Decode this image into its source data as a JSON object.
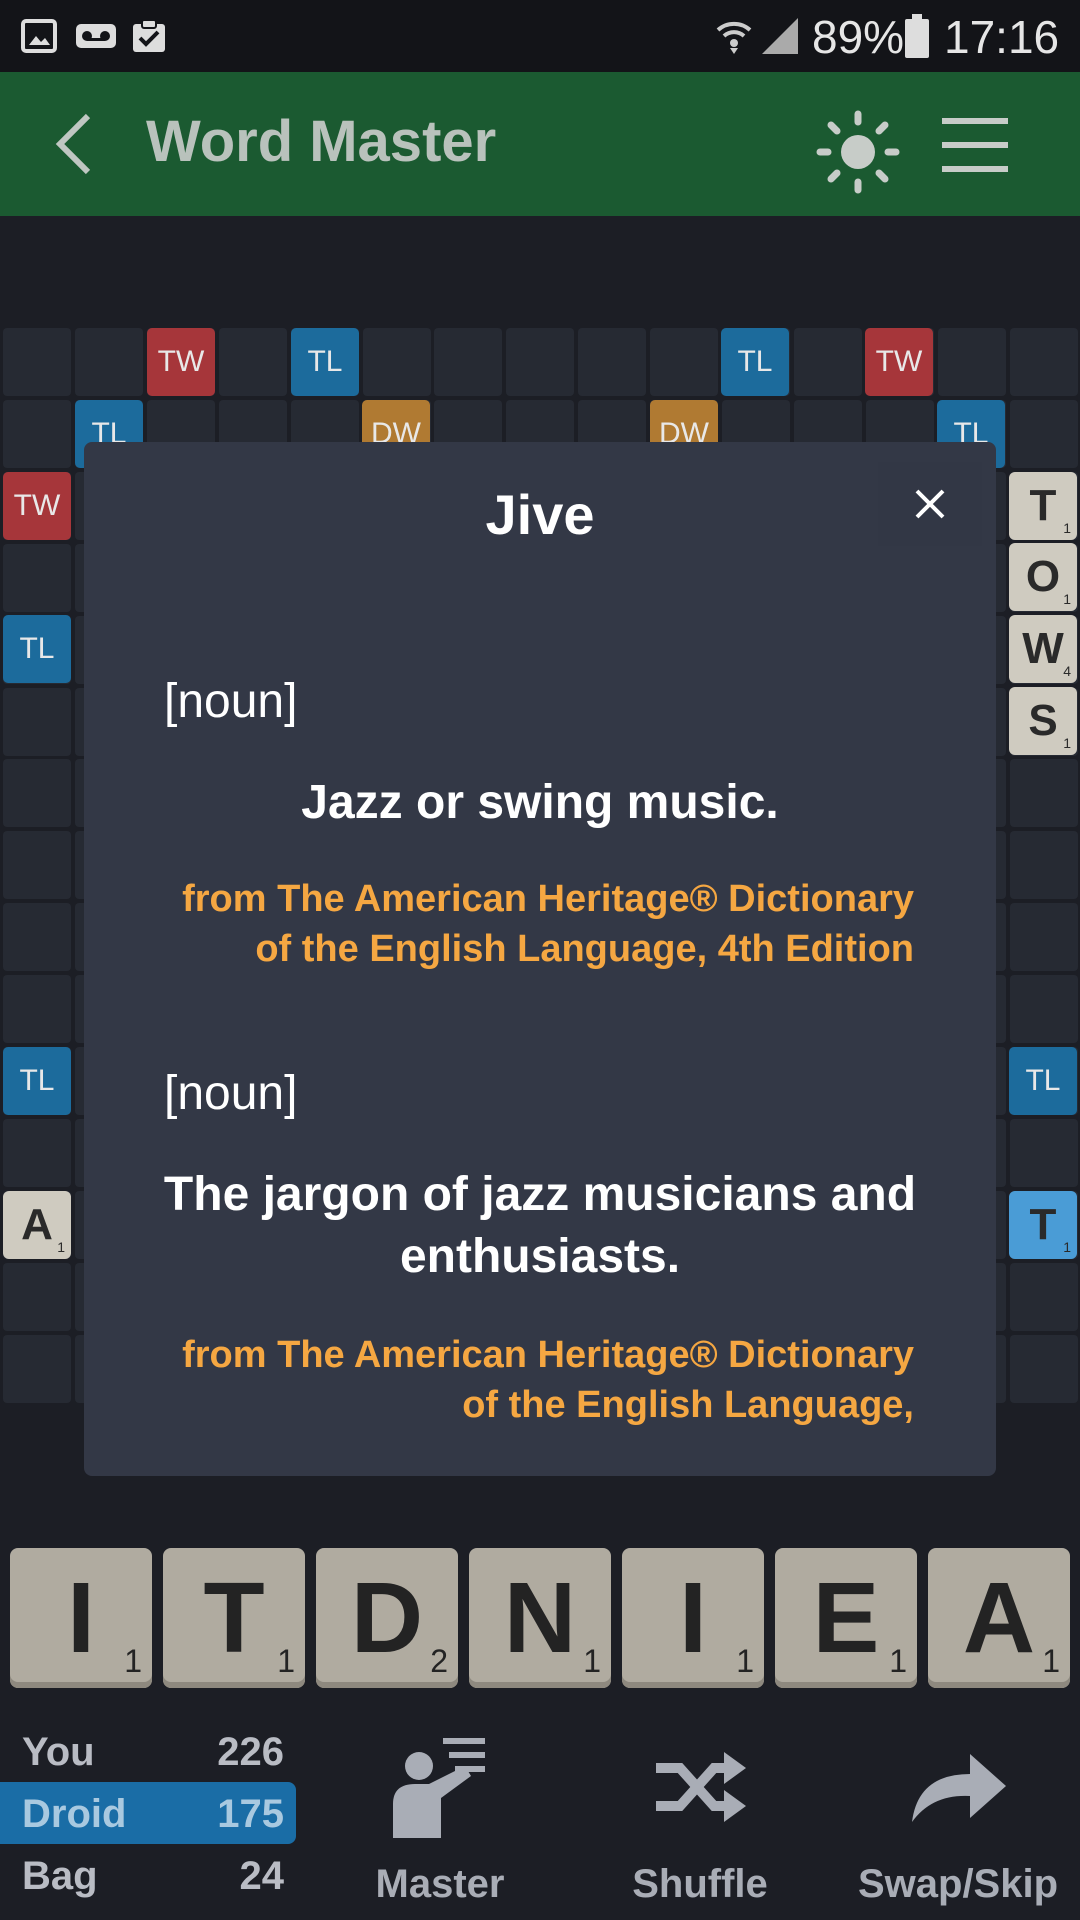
{
  "status_bar": {
    "battery": "89%",
    "time": "17:16"
  },
  "app_bar": {
    "title": "Word Master"
  },
  "board": {
    "bonus_labels": [
      "TW",
      "TL",
      "TL",
      "TW",
      "TL",
      "DW",
      "DW",
      "TL",
      "TW",
      "TL",
      "TL",
      "TL"
    ],
    "side_tiles": [
      {
        "letter": "T",
        "score": "1"
      },
      {
        "letter": "O",
        "score": "1"
      },
      {
        "letter": "W",
        "score": "4"
      },
      {
        "letter": "S",
        "score": "1"
      },
      {
        "letter": "A",
        "score": "1"
      },
      {
        "letter": "T",
        "score": "1"
      }
    ]
  },
  "dialog": {
    "word": "Jive",
    "definitions": [
      {
        "pos": "[noun]",
        "text": "Jazz or swing music.",
        "source": "from The American Heritage® Dictionary of the English Language, 4th Edition"
      },
      {
        "pos": "[noun]",
        "text": "The jargon of jazz musicians and enthusiasts.",
        "source": "from The American Heritage® Dictionary of the English Language,"
      }
    ]
  },
  "rack": [
    {
      "letter": "I",
      "score": "1"
    },
    {
      "letter": "T",
      "score": "1"
    },
    {
      "letter": "D",
      "score": "2"
    },
    {
      "letter": "N",
      "score": "1"
    },
    {
      "letter": "I",
      "score": "1"
    },
    {
      "letter": "E",
      "score": "1"
    },
    {
      "letter": "A",
      "score": "1"
    }
  ],
  "scores": [
    {
      "name": "You",
      "value": "226",
      "active": false
    },
    {
      "name": "Droid",
      "value": "175",
      "active": true
    },
    {
      "name": "Bag",
      "value": "24",
      "active": false
    }
  ],
  "actions": {
    "master": "Master",
    "shuffle": "Shuffle",
    "swap_skip": "Swap/Skip"
  },
  "colors": {
    "app_bar": "#1b5a31",
    "dialog": "#333846",
    "source_text": "#f5a742",
    "triple_word": "#a6363a",
    "triple_letter": "#1c6b9c",
    "double_word": "#b07a32",
    "active_score": "#1a6da6"
  }
}
